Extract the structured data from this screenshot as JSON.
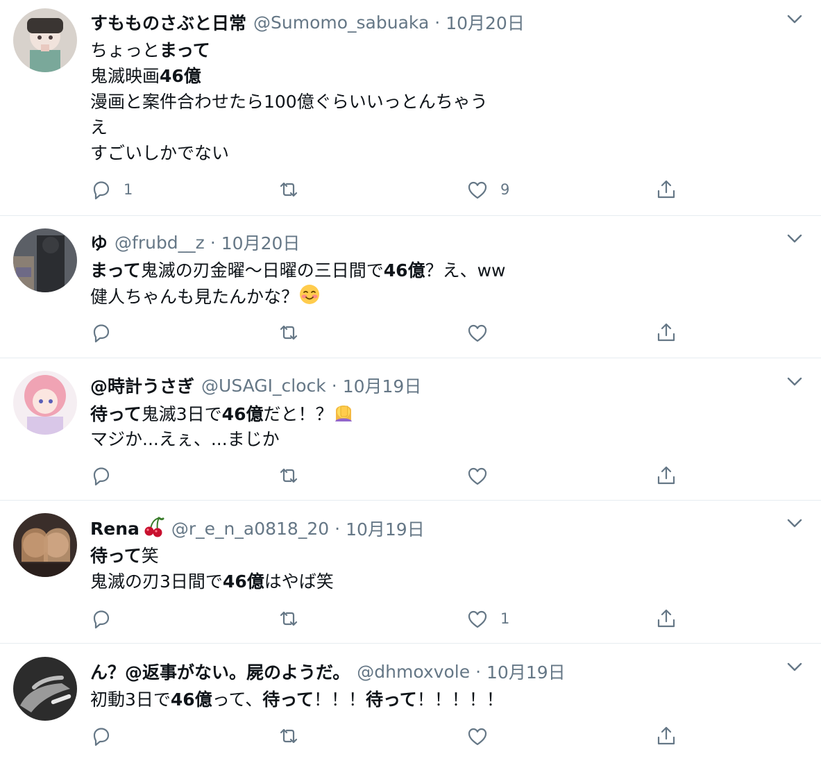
{
  "tweets": [
    {
      "name": "すもものさぶと日常",
      "handle": "@Sumomo_sabuaka",
      "time": "10月20日",
      "lines": [
        [
          {
            "t": "ちょっと",
            "b": false
          },
          {
            "t": "まって",
            "b": true
          }
        ],
        [
          {
            "t": "鬼滅映画",
            "b": false
          },
          {
            "t": "46億",
            "b": true
          }
        ],
        [
          {
            "t": "漫画と案件合わせたら100億ぐらいいっとんちゃう",
            "b": false
          }
        ],
        [
          {
            "t": "え",
            "b": false
          }
        ],
        [
          {
            "t": "すごいしかでない",
            "b": false
          }
        ]
      ],
      "reply_count": "1",
      "retweet_count": "",
      "like_count": "9"
    },
    {
      "name": "ゆ",
      "handle": "@frubd__z",
      "time": "10月20日",
      "lines": [
        [
          {
            "t": "まって",
            "b": true
          },
          {
            "t": "鬼滅の刃金曜〜日曜の三日間で",
            "b": false
          },
          {
            "t": "46億",
            "b": true
          },
          {
            "t": "？え、ww",
            "b": false
          }
        ],
        [
          {
            "t": "健人ちゃんも見たんかな？",
            "b": false
          },
          {
            "emoji": "smiling-face-emoji"
          }
        ]
      ],
      "reply_count": "",
      "retweet_count": "",
      "like_count": ""
    },
    {
      "name": "@時計うさぎ",
      "handle": "@USAGI_clock",
      "time": "10月19日",
      "lines": [
        [
          {
            "t": "待って",
            "b": true
          },
          {
            "t": "鬼滅3日で",
            "b": false
          },
          {
            "t": "46億",
            "b": true
          },
          {
            "t": "だと！？",
            "b": false
          },
          {
            "emoji": "facepalm-emoji"
          }
        ],
        [
          {
            "t": "マジか...えぇ、...まじか",
            "b": false
          }
        ]
      ],
      "reply_count": "",
      "retweet_count": "",
      "like_count": ""
    },
    {
      "name": "Rena",
      "name_emoji": "cherries-emoji",
      "handle": "@r_e_n_a0818_20",
      "time": "10月19日",
      "lines": [
        [
          {
            "t": "待って",
            "b": true
          },
          {
            "t": "笑",
            "b": false
          }
        ],
        [
          {
            "t": "鬼滅の刃3日間で",
            "b": false
          },
          {
            "t": "46億",
            "b": true
          },
          {
            "t": "はやば笑",
            "b": false
          }
        ]
      ],
      "reply_count": "",
      "retweet_count": "",
      "like_count": "1"
    },
    {
      "name": "ん？@返事がない。屍のようだ。",
      "handle": "@dhmoxvole",
      "time": "10月19日",
      "lines": [
        [
          {
            "t": "初動3日で",
            "b": false
          },
          {
            "t": "46億",
            "b": true
          },
          {
            "t": "って、",
            "b": false
          },
          {
            "t": "待って",
            "b": true
          },
          {
            "t": "！！！",
            "b": false
          },
          {
            "t": "待って",
            "b": true
          },
          {
            "t": "！！！！！",
            "b": false
          }
        ]
      ],
      "reply_count": "",
      "retweet_count": "",
      "like_count": ""
    }
  ],
  "separator": "·",
  "icons": {
    "reply": "reply-icon",
    "retweet": "retweet-icon",
    "like": "heart-icon",
    "share": "share-icon",
    "caret": "chevron-down-icon"
  },
  "colors": {
    "text": "#0f1419",
    "secondary": "#657786",
    "divider": "#e6ecf0"
  }
}
